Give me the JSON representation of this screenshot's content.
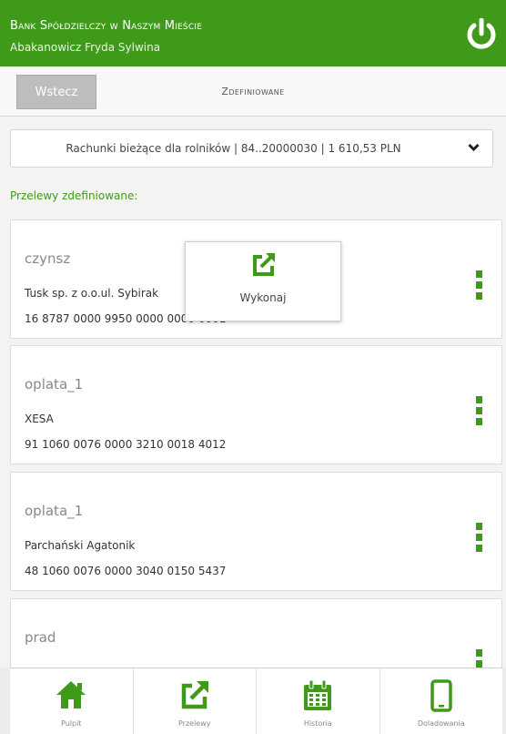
{
  "header": {
    "bank_name": "Bank Spółdzielczy w Naszym Mieście",
    "user_name": "Abakanowicz Fryda Sylwina"
  },
  "toolbar": {
    "back_label": "Wstecz",
    "title": "Zdefiniowane"
  },
  "account": {
    "selected": "Rachunki bieżące dla rolników | 84..20000030 | 1 610,53 PLN"
  },
  "section_label": "Przelewy zdefiniowane:",
  "transfers": [
    {
      "name": "czynsz",
      "recipient": "Tusk sp. z o.o.ul. Sybirak",
      "account": "16 8787 0000 9950 0000 0000 0001"
    },
    {
      "name": "oplata_1",
      "recipient": "XESA",
      "account": "91 1060 0076 0000 3210 0018 4012"
    },
    {
      "name": "oplata_1",
      "recipient": "Parchański Agatonik",
      "account": "48 1060 0076 0000 3040 0150 5437"
    },
    {
      "name": "prad",
      "recipient": "",
      "account": ""
    }
  ],
  "popup": {
    "label": "Wykonaj",
    "icon": "execute-icon"
  },
  "bottom_nav": [
    {
      "label": "Pulpit",
      "icon": "home-icon"
    },
    {
      "label": "Przelewy",
      "icon": "transfer-icon"
    },
    {
      "label": "Historia",
      "icon": "calendar-icon"
    },
    {
      "label": "Doladowania",
      "icon": "phone-icon"
    }
  ],
  "colors": {
    "brand_green": "#3f9a1a",
    "back_button": "#bdbdbd"
  }
}
